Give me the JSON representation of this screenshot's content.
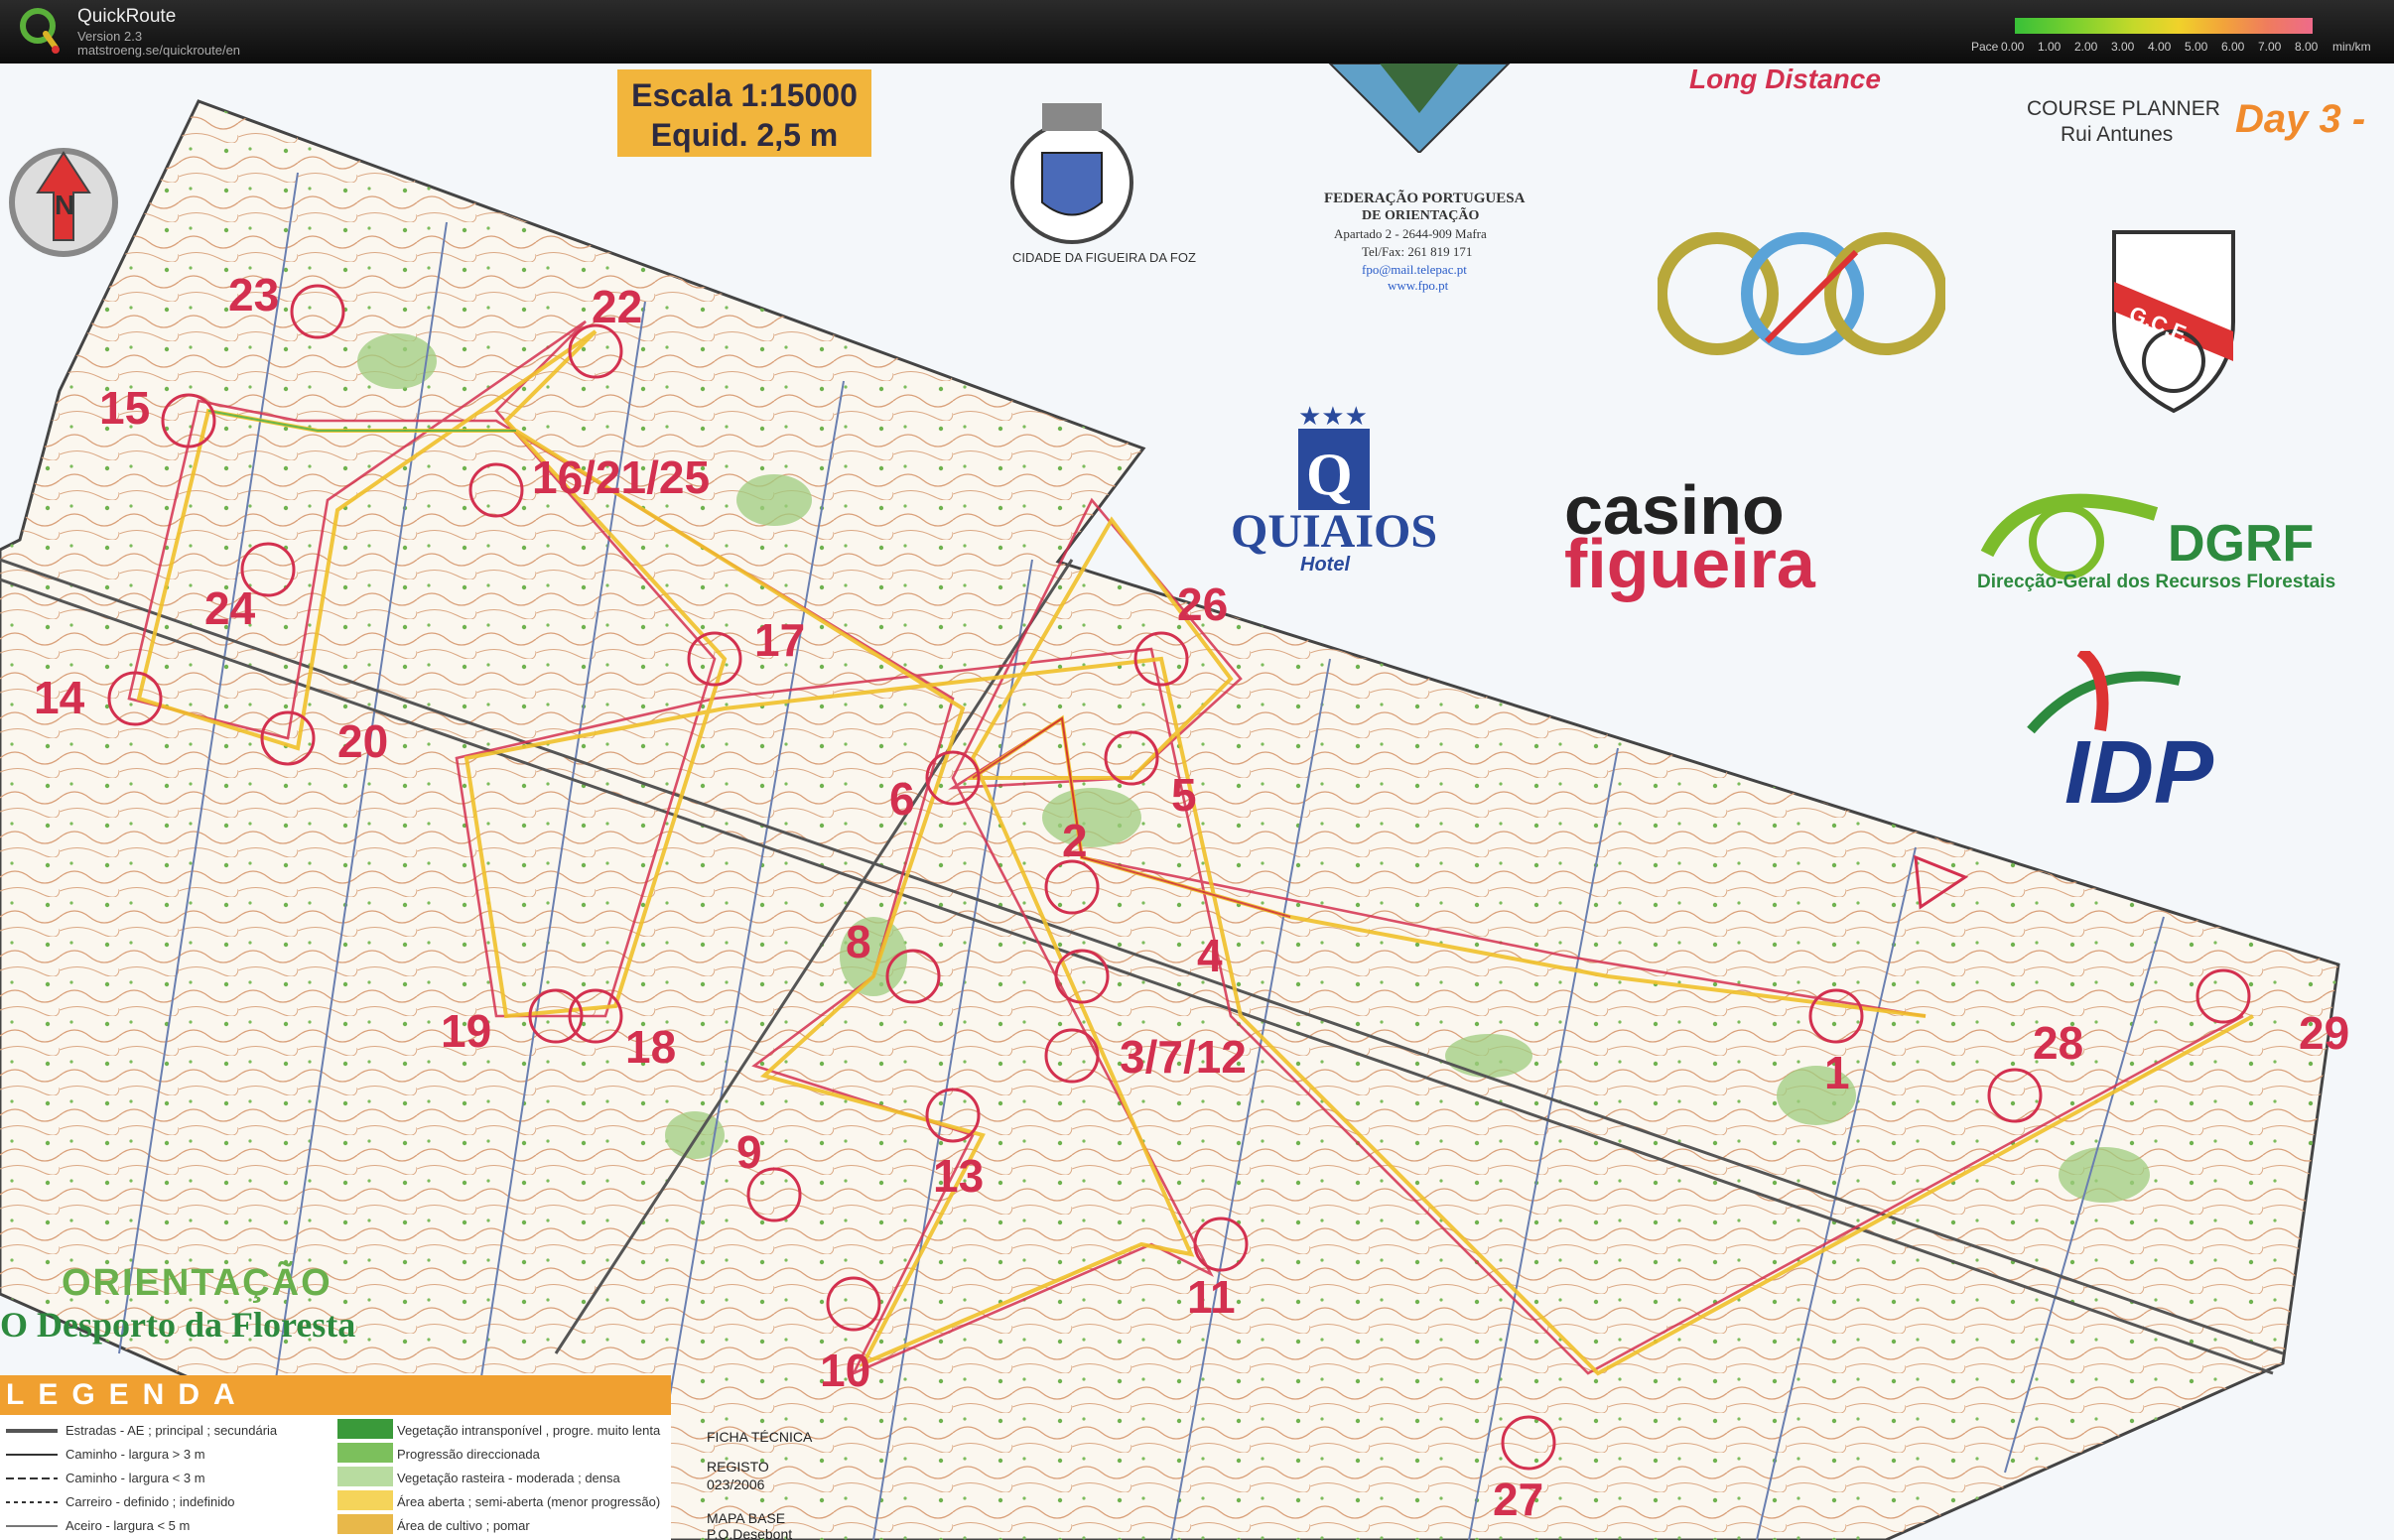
{
  "app": {
    "name": "QuickRoute",
    "version": "Version 2.3",
    "url": "matstroeng.se/quickroute/en"
  },
  "pace_legend": {
    "title": "Pace",
    "ticks": [
      "0.00",
      "1.00",
      "2.00",
      "3.00",
      "4.00",
      "5.00",
      "6.00",
      "7.00",
      "8.00"
    ],
    "unit": "min/km",
    "colors": [
      "#38c038",
      "#c5d92a",
      "#f0d22a",
      "#f2a43a",
      "#ee6a8a"
    ]
  },
  "map": {
    "scale": "Escala 1:15000",
    "equid": "Equid. 2,5 m",
    "event": "Long Distance",
    "day": "Day 3 -",
    "course_planner_label": "COURSE PLANNER",
    "course_planner_name": "Rui Antunes",
    "federation": [
      "FEDERAÇÃO PORTUGUESA",
      "DE ORIENTAÇÃO",
      "Apartado 2 - 2644-909 Mafra",
      "Tel/Fax: 261 819 171",
      "fpo@mail.telepac.pt",
      "www.fpo.pt"
    ],
    "city_seal": "CIDADE DA FIGUEIRA DA FOZ",
    "hotel": "QUIAIOS",
    "hotel_sub": "Hotel",
    "casino_1": "casino",
    "casino_2": "figueira",
    "dgrf": "DGRF",
    "dgrf_sub": "Direcção-Geral dos Recursos Florestais",
    "idp": "IDP",
    "gcf": "G.C.F.",
    "slogan_1": "ORIENTAÇÃO",
    "slogan_2": "O Desporto da Floresta",
    "legend_title": "LEGENDA",
    "legend_left": [
      "Estradas - AE ; principal ; secundária",
      "Caminho - largura > 3 m",
      "Caminho - largura < 3 m",
      "Carreiro - definido ; indefinido",
      "Aceiro - largura < 5 m"
    ],
    "legend_right": [
      "Vegetação intransponível , progre. muito lenta",
      "Progressão direccionada",
      "Vegetação rasteira - moderada ; densa",
      "Área aberta ; semi-aberta (menor progressão)",
      "Área de cultivo ; pomar"
    ],
    "tech": [
      "FICHA TÉCNICA",
      "REGISTO",
      "023/2006",
      "MAPA BASE",
      "P.O.Desebont"
    ],
    "controls": [
      "23",
      "22",
      "15",
      "16/21/25",
      "24",
      "14",
      "20",
      "17",
      "26",
      "6",
      "5",
      "2",
      "8",
      "4",
      "19",
      "18",
      "3/7/12",
      "9",
      "13",
      "11",
      "10",
      "27",
      "1",
      "28",
      "29"
    ]
  }
}
